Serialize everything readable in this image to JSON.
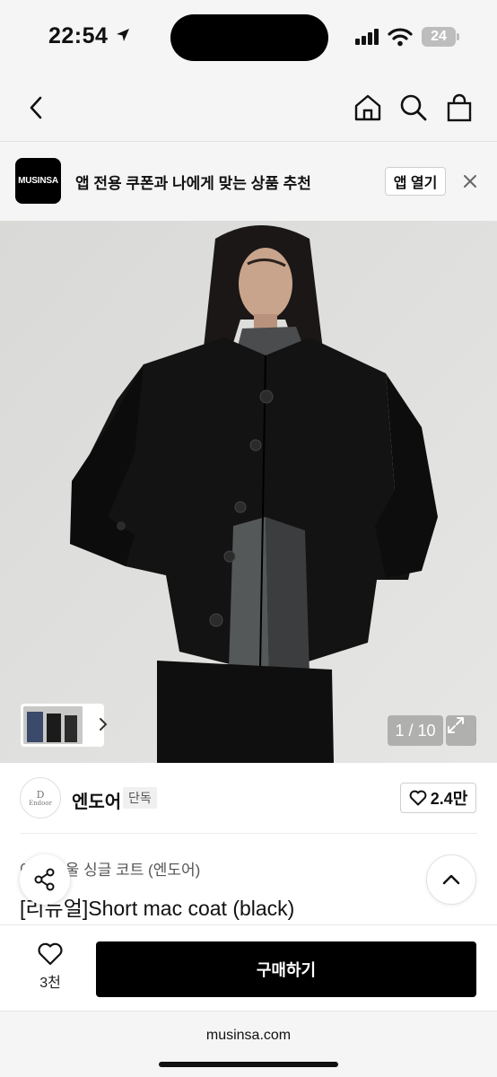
{
  "status_bar": {
    "time": "22:54",
    "battery": "24"
  },
  "nav": {
    "back_label": "back",
    "home_label": "home",
    "search_label": "search",
    "cart_label": "cart"
  },
  "app_banner": {
    "logo_text": "MUSINSA",
    "text": "앱 전용 쿠폰과 나에게 맞는 상품 추천",
    "open_button": "앱 열기"
  },
  "gallery": {
    "counter": "1 / 10"
  },
  "brand": {
    "logo_letter": "D",
    "logo_sub": "Endoor",
    "name": "엔도어",
    "badge": "단독",
    "likes": "2.4만"
  },
  "product": {
    "breadcrumb_prefix": "아",
    "breadcrumb_sep": ">",
    "breadcrumb_category": "겨울 싱글 코트 (엔도어)",
    "title": "[리뉴얼]Short mac coat (black)"
  },
  "buy_bar": {
    "wish_count": "3천",
    "buy_label": "구매하기"
  },
  "url_bar": {
    "url": "musinsa.com"
  },
  "colors": {
    "accent": "#000000",
    "background": "#f5f5f5"
  }
}
